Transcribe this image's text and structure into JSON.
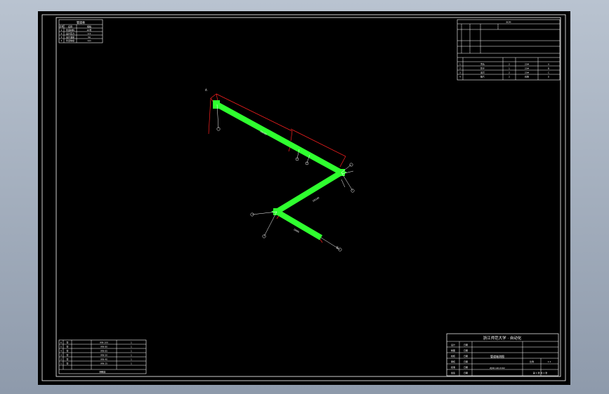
{
  "drawing": {
    "left_table": {
      "title": "管道表",
      "headers": [
        "序号",
        "名称",
        "规格"
      ],
      "rows": [
        [
          "1",
          "管道材料",
          "20号"
        ],
        [
          "2",
          "设计压力",
          "0.5"
        ],
        [
          "3",
          "设计温度",
          "50"
        ],
        [
          "4",
          "管道等级",
          "1A1"
        ]
      ]
    },
    "right_table": {
      "title": "BOM",
      "rows": [
        [
          "1",
          "弯头",
          "2",
          "20#",
          "A"
        ],
        [
          "2",
          "管子",
          "1",
          "20#",
          "B"
        ],
        [
          "3",
          "法兰",
          "2",
          "20#",
          "C"
        ],
        [
          "4",
          "垫片",
          "2",
          "石棉",
          "D"
        ],
        [
          "5",
          "螺栓",
          "8",
          "35#",
          "E"
        ]
      ]
    },
    "bottom_left_table": {
      "footer": "明细表",
      "rows": [
        [
          "6",
          "管",
          "WN-100",
          "1"
        ],
        [
          "5",
          "管",
          "WN-80",
          "1"
        ],
        [
          "4",
          "管",
          "WN-65",
          "1"
        ],
        [
          "3",
          "管",
          "WN-50",
          "1"
        ],
        [
          "2",
          "管",
          "WN-40",
          "1"
        ],
        [
          "1",
          "管",
          "WN-25",
          "1"
        ]
      ]
    },
    "title_block": {
      "school": "浙江师范大学 · 自动化",
      "drawing_title": "管道轴测图",
      "drawing_no": "ZJSD-GD-0102",
      "scale_label": "比例",
      "scale": "1:1",
      "sheet": "第 1 张 共 1 张",
      "rows": [
        [
          "设计",
          "",
          "日期"
        ],
        [
          "制图",
          "",
          "日期"
        ],
        [
          "校核",
          "",
          "日期"
        ],
        [
          "审核",
          "",
          "日期"
        ],
        [
          "批准",
          "",
          "日期"
        ],
        [
          "会签",
          "",
          "日期"
        ]
      ]
    },
    "pipe_tags": {
      "start": "A",
      "end": "B",
      "seg1": "DN100",
      "seg2": "DN100",
      "seg3": "DN80"
    },
    "colors": {
      "pipe": "#2fff2f",
      "dimension": "#ff2020",
      "lines": "#ffffff",
      "background": "#000000"
    }
  }
}
